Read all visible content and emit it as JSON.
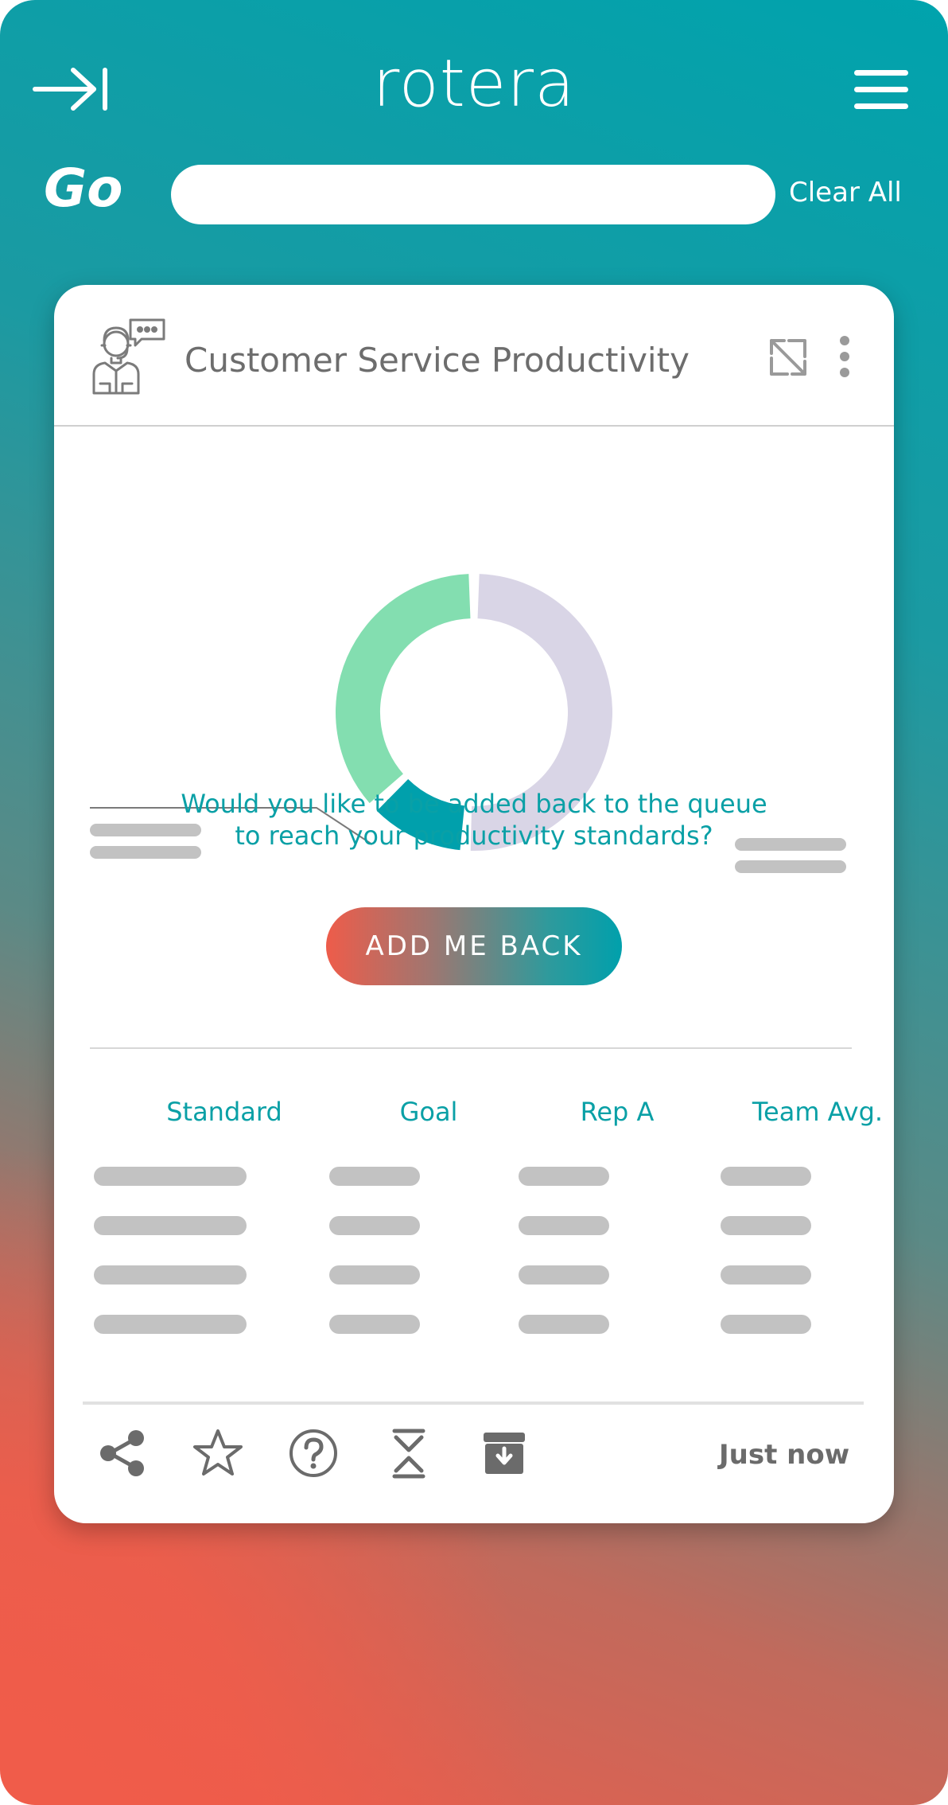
{
  "app": {
    "logo": "rotera"
  },
  "search": {
    "go_label": "Go",
    "value": "",
    "placeholder": "",
    "clear_label": "Clear All"
  },
  "card": {
    "title": "Customer Service Productivity",
    "prompt_line1": "Would you like to be added back to the queue",
    "prompt_line2": "to reach your productivity standards?",
    "button_label": "ADD ME BACK",
    "columns": [
      "Standard",
      "Goal",
      "Rep A",
      "Team Avg."
    ],
    "timestamp": "Just now"
  },
  "chart_data": {
    "type": "pie",
    "style": "donut",
    "slices": [
      {
        "color": "#d9d5e6",
        "value": 51
      },
      {
        "color": "#00a0ac",
        "value": 12
      },
      {
        "color": "#83deb0",
        "value": 37
      }
    ]
  },
  "icons": {
    "header": [
      "collapse-to-right-icon",
      "hamburger-menu-icon"
    ],
    "card": [
      "customer-service-agent-icon",
      "expand-icon",
      "kebab-menu-icon"
    ],
    "footer": [
      "share-icon",
      "star-icon",
      "help-icon",
      "collapse-icon",
      "archive-icon"
    ]
  },
  "colors": {
    "accent": "#00a0ac",
    "brand_coral": "#ef5c4b",
    "placeholder": "#c2c2c2"
  }
}
